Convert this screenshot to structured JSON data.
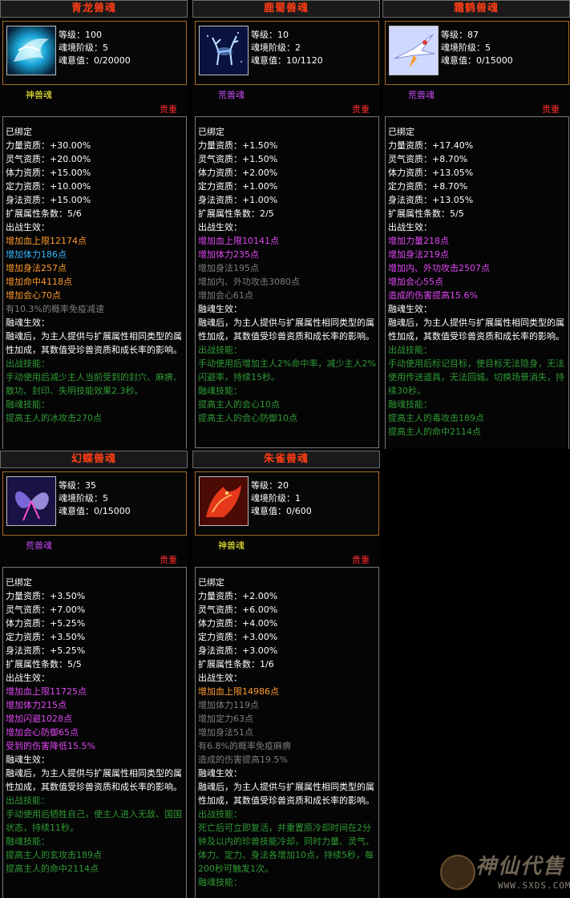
{
  "colors": {
    "white": "#ffffff",
    "orange": "#ff9a2c",
    "cyan": "#37b7ff",
    "magenta": "#e048f4",
    "gray": "#7e7e7e",
    "green": "#2f9a35",
    "yellow": "#ffff3a",
    "purple": "#c34bf2",
    "red": "#ff2a2a"
  },
  "cards": [
    {
      "title": "青龙兽魂",
      "icon": "azure-dragon-icon",
      "stats": [
        "等级：100",
        "魂境阶级：5",
        "魂意值：0/20000"
      ],
      "tier": {
        "text": "神兽魂",
        "color": "yellow"
      },
      "rarity": "贵重",
      "lines": [
        {
          "text": "已绑定",
          "color": "white"
        },
        {
          "text": "力量资质：+30.00%",
          "color": "white"
        },
        {
          "text": "灵气资质：+20.00%",
          "color": "white"
        },
        {
          "text": "体力资质：+15.00%",
          "color": "white"
        },
        {
          "text": "定力资质：+10.00%",
          "color": "white"
        },
        {
          "text": "身法资质：+15.00%",
          "color": "white"
        },
        {
          "text": "扩展属性条数：5/6",
          "color": "white"
        },
        {
          "text": "出战生效：",
          "color": "white"
        },
        {
          "text": "增加血上限12174点",
          "color": "orange"
        },
        {
          "text": "增加体力186点",
          "color": "cyan"
        },
        {
          "text": "增加身法257点",
          "color": "orange"
        },
        {
          "text": "增加命中4118点",
          "color": "orange"
        },
        {
          "text": "增加会心70点",
          "color": "orange"
        },
        {
          "text": "有10.3%的概率免疫减速",
          "color": "gray"
        },
        {
          "text": "融魂生效：",
          "color": "white"
        },
        {
          "text": "融魂后，为主人提供与扩展属性相同类型的属性加成，其数值受珍兽资质和成长率的影响。",
          "color": "white",
          "wrap": true
        },
        {
          "text": "出战技能：",
          "color": "green"
        },
        {
          "text": "手动使用后减少主人当前受到的封穴、麻痹、散功、封印、失明技能效果2.3秒。",
          "color": "green",
          "wrap": true
        },
        {
          "text": "融魂技能：",
          "color": "green"
        },
        {
          "text": "提高主人的冰攻击270点",
          "color": "green"
        }
      ]
    },
    {
      "title": "鹿蜀兽魂",
      "icon": "star-deer-icon",
      "stats": [
        "等级：10",
        "魂境阶级：2",
        "魂意值：10/1120"
      ],
      "tier": {
        "text": "荒兽魂",
        "color": "purple"
      },
      "rarity": "贵重",
      "lines": [
        {
          "text": "已绑定",
          "color": "white"
        },
        {
          "text": "力量资质：+1.50%",
          "color": "white"
        },
        {
          "text": "灵气资质：+1.50%",
          "color": "white"
        },
        {
          "text": "体力资质：+2.00%",
          "color": "white"
        },
        {
          "text": "定力资质：+1.00%",
          "color": "white"
        },
        {
          "text": "身法资质：+1.00%",
          "color": "white"
        },
        {
          "text": "扩展属性条数：2/5",
          "color": "white"
        },
        {
          "text": "出战生效：",
          "color": "white"
        },
        {
          "text": "增加血上限10141点",
          "color": "magenta"
        },
        {
          "text": "增加体力235点",
          "color": "magenta"
        },
        {
          "text": "增加身法195点",
          "color": "gray"
        },
        {
          "text": "增加内、外功攻击3080点",
          "color": "gray"
        },
        {
          "text": "增加会心61点",
          "color": "gray"
        },
        {
          "text": "融魂生效：",
          "color": "white"
        },
        {
          "text": "融魂后，为主人提供与扩展属性相同类型的属性加成，其数值受珍兽资质和成长率的影响。",
          "color": "white",
          "wrap": true
        },
        {
          "text": "出战技能：",
          "color": "green"
        },
        {
          "text": "手动使用后增加主人2%命中率，减少主人2%闪避率，持续15秒。",
          "color": "green",
          "wrap": true
        },
        {
          "text": "融魂技能：",
          "color": "green"
        },
        {
          "text": "提高主人的会心10点",
          "color": "green"
        },
        {
          "text": "提高主人的会心防御10点",
          "color": "green"
        }
      ]
    },
    {
      "title": "霜鹤兽魂",
      "icon": "frost-crane-icon",
      "stats": [
        "等级：87",
        "魂境阶级：5",
        "魂意值：0/15000"
      ],
      "tier": {
        "text": "荒兽魂",
        "color": "purple"
      },
      "rarity": "贵重",
      "lines": [
        {
          "text": "已绑定",
          "color": "white"
        },
        {
          "text": "力量资质：+17.40%",
          "color": "white"
        },
        {
          "text": "灵气资质：+8.70%",
          "color": "white"
        },
        {
          "text": "体力资质：+13.05%",
          "color": "white"
        },
        {
          "text": "定力资质：+8.70%",
          "color": "white"
        },
        {
          "text": "身法资质：+13.05%",
          "color": "white"
        },
        {
          "text": "扩展属性条数：5/5",
          "color": "white"
        },
        {
          "text": "出战生效：",
          "color": "white"
        },
        {
          "text": "增加力量218点",
          "color": "magenta"
        },
        {
          "text": "增加身法219点",
          "color": "magenta"
        },
        {
          "text": "增加内、外功攻击2507点",
          "color": "magenta"
        },
        {
          "text": "增加会心55点",
          "color": "magenta"
        },
        {
          "text": "造成的伤害提高15.6%",
          "color": "magenta"
        },
        {
          "text": "融魂生效：",
          "color": "white"
        },
        {
          "text": "融魂后，为主人提供与扩展属性相同类型的属性加成，其数值受珍兽资质和成长率的影响。",
          "color": "white",
          "wrap": true
        },
        {
          "text": "出战技能：",
          "color": "green"
        },
        {
          "text": "手动使用后标记目标，使目标无法隐身，无法使用传送道具，无法回城。切换场景消失，持续30秒。",
          "color": "green",
          "wrap": true
        },
        {
          "text": "融魂技能：",
          "color": "green"
        },
        {
          "text": "提高主人的毒攻击189点",
          "color": "green"
        },
        {
          "text": "提高主人的命中2114点",
          "color": "green"
        }
      ]
    },
    {
      "title": "幻蝶兽魂",
      "icon": "phantom-butterfly-icon",
      "stats": [
        "等级：35",
        "魂境阶级：5",
        "魂意值：0/15000"
      ],
      "tier": {
        "text": "荒兽魂",
        "color": "purple"
      },
      "rarity": "贵重",
      "lines": [
        {
          "text": "已绑定",
          "color": "white"
        },
        {
          "text": "力量资质：+3.50%",
          "color": "white"
        },
        {
          "text": "灵气资质：+7.00%",
          "color": "white"
        },
        {
          "text": "体力资质：+5.25%",
          "color": "white"
        },
        {
          "text": "定力资质：+3.50%",
          "color": "white"
        },
        {
          "text": "身法资质：+5.25%",
          "color": "white"
        },
        {
          "text": "扩展属性条数：5/5",
          "color": "white"
        },
        {
          "text": "出战生效：",
          "color": "white"
        },
        {
          "text": "增加血上限11725点",
          "color": "magenta"
        },
        {
          "text": "增加体力215点",
          "color": "magenta"
        },
        {
          "text": "增加闪避1028点",
          "color": "magenta"
        },
        {
          "text": "增加会心防御65点",
          "color": "magenta"
        },
        {
          "text": "受到的伤害降低15.5%",
          "color": "magenta"
        },
        {
          "text": "融魂生效：",
          "color": "white"
        },
        {
          "text": "融魂后，为主人提供与扩展属性相同类型的属性加成，其数值受珍兽资质和成长率的影响。",
          "color": "white",
          "wrap": true
        },
        {
          "text": "出战技能：",
          "color": "green"
        },
        {
          "text": "手动使用后牺牲自己，使主人进入无敌、国国状态，持续11秒。",
          "color": "green",
          "wrap": true
        },
        {
          "text": "融魂技能：",
          "color": "green"
        },
        {
          "text": "提高主人的玄攻击189点",
          "color": "green"
        },
        {
          "text": "提高主人的命中2114点",
          "color": "green"
        }
      ]
    },
    {
      "title": "朱雀兽魂",
      "icon": "vermilion-bird-icon",
      "stats": [
        "等级：20",
        "魂境阶级：1",
        "魂意值：0/600"
      ],
      "tier": {
        "text": "神兽魂",
        "color": "yellow"
      },
      "rarity": "贵重",
      "lines": [
        {
          "text": "已绑定",
          "color": "white"
        },
        {
          "text": "力量资质：+2.00%",
          "color": "white"
        },
        {
          "text": "灵气资质：+6.00%",
          "color": "white"
        },
        {
          "text": "体力资质：+4.00%",
          "color": "white"
        },
        {
          "text": "定力资质：+3.00%",
          "color": "white"
        },
        {
          "text": "身法资质：+3.00%",
          "color": "white"
        },
        {
          "text": "扩展属性条数：1/6",
          "color": "white"
        },
        {
          "text": "出战生效：",
          "color": "white"
        },
        {
          "text": "增加血上限14986点",
          "color": "orange"
        },
        {
          "text": "增加体力119点",
          "color": "gray"
        },
        {
          "text": "增加定力63点",
          "color": "gray"
        },
        {
          "text": "增加身法51点",
          "color": "gray"
        },
        {
          "text": "有6.8%的概率免疫麻痹",
          "color": "gray"
        },
        {
          "text": "造成的伤害提高19.5%",
          "color": "gray"
        },
        {
          "text": "融魂生效：",
          "color": "white"
        },
        {
          "text": "融魂后，为主人提供与扩展属性相同类型的属性加成，其数值受珍兽资质和成长率的影响。",
          "color": "white",
          "wrap": true
        },
        {
          "text": "出战技能：",
          "color": "green"
        },
        {
          "text": "死亡后可立即复活，并重置原冷却时间在2分钟及以内的珍兽技能冷却，同时力量、灵气、体力、定力、身法各增加10点，持续5秒，每200秒可触发1次。",
          "color": "green",
          "wrap": true
        },
        {
          "text": "融魂技能：",
          "color": "green"
        }
      ]
    }
  ],
  "watermark": {
    "logo": "神仙代售",
    "url": "WWW.SXDS.COM",
    "icon": "mascot-icon"
  }
}
